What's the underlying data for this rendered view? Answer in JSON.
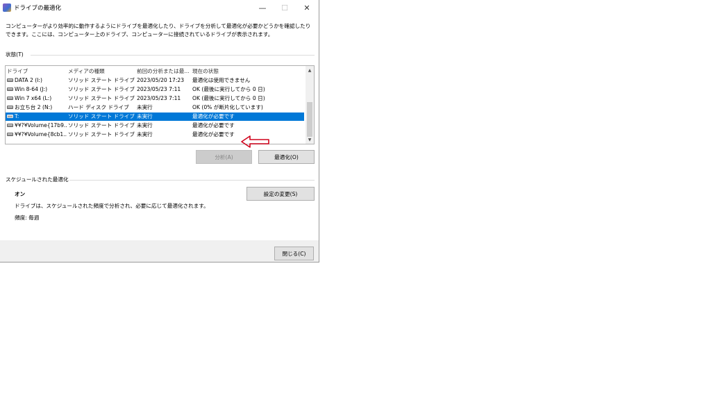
{
  "window": {
    "title": "ドライブの最適化",
    "icons": {
      "app": "defrag-app-icon",
      "minimize": "minimize-icon",
      "maximize": "maximize-icon",
      "close": "close-icon"
    },
    "minimize_glyph": "—",
    "maximize_glyph": "☐",
    "close_glyph": "✕"
  },
  "description": "コンピューターがより効率的に動作するようにドライブを最適化したり、ドライブを分析して最適化が必要かどうかを確認したりできます。ここには、コンピューター上のドライブ、コンピューターに接続されているドライブが表示されます。",
  "status": {
    "label": "状態(T)",
    "columns": [
      "ドライブ",
      "メディアの種類",
      "前回の分析または最...",
      "現在の状態"
    ],
    "rows": [
      {
        "drive": "DATA 2 (I:)",
        "media": "ソリッド ステート ドライブ",
        "last": "2023/05/20 17:23",
        "state": "最適化は使用できません",
        "selected": false
      },
      {
        "drive": "Win 8-64 (J:)",
        "media": "ソリッド ステート ドライブ",
        "last": "2023/05/23 7:11",
        "state": "OK (最後に実行してから 0 日)",
        "selected": false
      },
      {
        "drive": "Win 7 x64 (L:)",
        "media": "ソリッド ステート ドライブ",
        "last": "2023/05/23 7:11",
        "state": "OK (最後に実行してから 0 日)",
        "selected": false
      },
      {
        "drive": "お立ち台 2 (N:)",
        "media": "ハード ディスク ドライブ",
        "last": "未実行",
        "state": "OK (0% が断片化しています)",
        "selected": false
      },
      {
        "drive": "T:",
        "media": "ソリッド ステート ドライブ",
        "last": "未実行",
        "state": "最適化が必要です",
        "selected": true
      },
      {
        "drive": "¥¥?¥Volume{17b9...",
        "media": "ソリッド ステート ドライブ",
        "last": "未実行",
        "state": "最適化が必要です",
        "selected": false
      },
      {
        "drive": "¥¥?¥Volume{8cb1...",
        "media": "ソリッド ステート ドライブ",
        "last": "未実行",
        "state": "最適化が必要です",
        "selected": false
      }
    ],
    "row_icon": "drive-icon",
    "scroll_up_glyph": "▲",
    "scroll_down_glyph": "▼"
  },
  "buttons": {
    "analyze": "分析(A)",
    "optimize": "最適化(O)",
    "change_settings": "設定の変更(S)",
    "close": "閉じる(C)"
  },
  "schedule": {
    "label": "スケジュールされた最適化",
    "state": "オン",
    "desc": "ドライブは、スケジュールされた頻度で分析され、必要に応じて最適化されます。",
    "frequency": "頻度: 毎週"
  },
  "annotation": {
    "arrow_icon": "red-arrow-icon",
    "color": "#d0021b"
  },
  "colors": {
    "selection": "#0078d7",
    "dialog_bg": "#f0f0f0"
  }
}
